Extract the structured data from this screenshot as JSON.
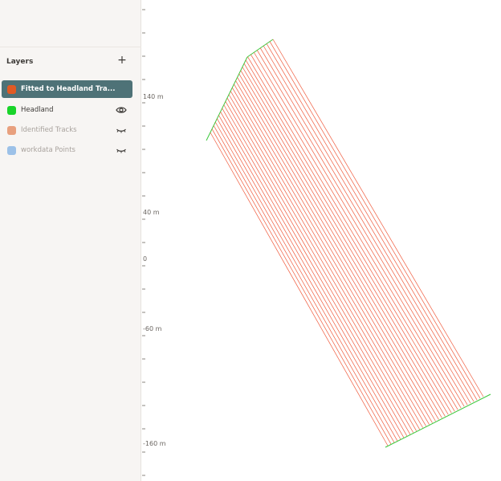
{
  "sidebar": {
    "title": "Layers",
    "add_label": "+",
    "items": [
      {
        "label": "Fitted to Headland Tra...",
        "color": "#e05a24",
        "active": true,
        "visibility": ""
      },
      {
        "label": "Headland",
        "color": "#19d42a",
        "active": false,
        "visibility": "eye-open"
      },
      {
        "label": "Identified Tracks",
        "color": "#e8a07e",
        "active": false,
        "visibility": "eye-closed"
      },
      {
        "label": "workdata Points",
        "color": "#9cc1e8",
        "active": false,
        "visibility": "eye-closed"
      }
    ]
  },
  "axis": {
    "labels": [
      "140 m",
      "40 m",
      "0",
      "-60 m",
      "-160 m"
    ]
  },
  "colors": {
    "tracks": "#f05a3c",
    "headland": "#3cc83c"
  }
}
